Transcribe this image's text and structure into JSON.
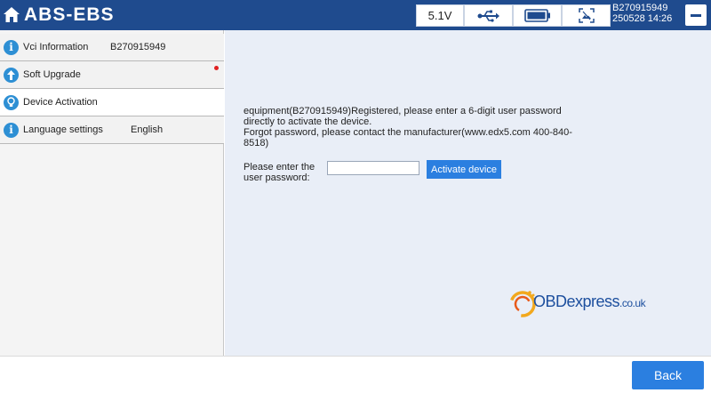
{
  "header": {
    "title": "ABS-EBS",
    "voltage": "5.1V",
    "device_id": "B270915949",
    "datetime": "250528 14:26",
    "icons": [
      "home-icon",
      "usb-icon",
      "battery-icon",
      "screenshot-icon",
      "minimize-icon"
    ]
  },
  "sidebar": {
    "items": [
      {
        "label": "Vci Information",
        "value": "B270915949",
        "icon": "info-icon"
      },
      {
        "label": "Soft Upgrade",
        "value": "",
        "icon": "upgrade-icon"
      },
      {
        "label": "Device Activation",
        "value": "",
        "icon": "activation-icon"
      },
      {
        "label": "Language settings",
        "value": "English",
        "icon": "info-icon"
      }
    ]
  },
  "main": {
    "message_line1": "equipment(B270915949)Registered, please enter a 6-digit user password directly to activate the device.",
    "message_line2": "Forgot password, please contact the manufacturer(www.edx5.com  400-840-8518)",
    "password_label": "Please enter the user password:",
    "password_value": "",
    "activate_label": "Activate device",
    "watermark_brand": "OBDexpress",
    "watermark_suffix": ".co.uk"
  },
  "footer": {
    "back_label": "Back"
  },
  "colors": {
    "header_bg": "#1f4b8e",
    "accent_blue": "#2b7fe0",
    "main_bg": "#e9eef7",
    "notify_dot": "#e02020"
  }
}
